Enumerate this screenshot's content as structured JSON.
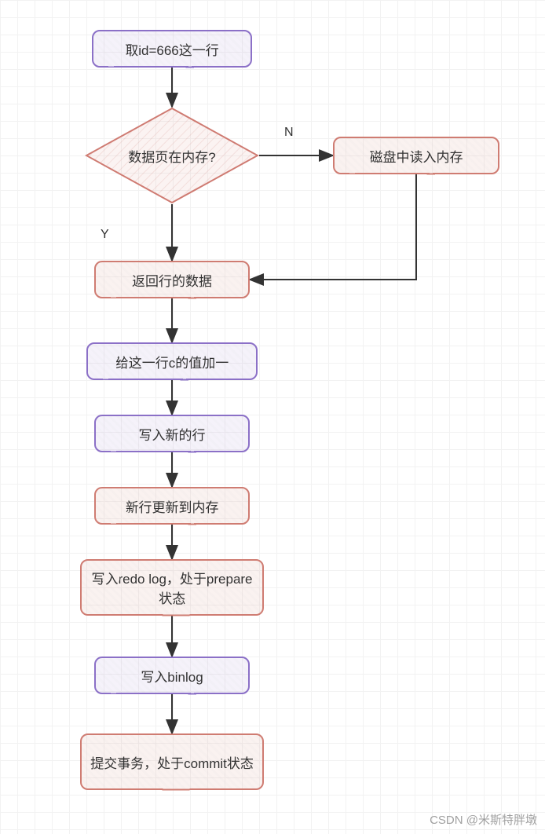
{
  "nodes": {
    "n1": {
      "text": "取id=666这一行"
    },
    "n2": {
      "text": "数据页在内存?"
    },
    "n3": {
      "text": "磁盘中读入内存"
    },
    "n4": {
      "text": "返回行的数据"
    },
    "n5": {
      "text": "给这一行c的值加一"
    },
    "n6": {
      "text": "写入新的行"
    },
    "n7": {
      "text": "新行更新到内存"
    },
    "n8": {
      "text": "写入redo log，处于prepare状态"
    },
    "n9": {
      "text": "写入binlog"
    },
    "n10": {
      "text": "提交事务，处于commit状态"
    }
  },
  "labels": {
    "yes": "Y",
    "no": "N"
  },
  "watermark": "CSDN @米斯特胖墩",
  "chart_data": {
    "type": "flowchart",
    "title": "",
    "nodes": [
      {
        "id": "n1",
        "type": "process",
        "text": "取id=666这一行",
        "style": "purple"
      },
      {
        "id": "n2",
        "type": "decision",
        "text": "数据页在内存?",
        "style": "red"
      },
      {
        "id": "n3",
        "type": "process",
        "text": "磁盘中读入内存",
        "style": "red"
      },
      {
        "id": "n4",
        "type": "process",
        "text": "返回行的数据",
        "style": "red"
      },
      {
        "id": "n5",
        "type": "process",
        "text": "给这一行c的值加一",
        "style": "purple"
      },
      {
        "id": "n6",
        "type": "process",
        "text": "写入新的行",
        "style": "purple"
      },
      {
        "id": "n7",
        "type": "process",
        "text": "新行更新到内存",
        "style": "red"
      },
      {
        "id": "n8",
        "type": "process",
        "text": "写入redo log，处于prepare状态",
        "style": "red"
      },
      {
        "id": "n9",
        "type": "process",
        "text": "写入binlog",
        "style": "purple"
      },
      {
        "id": "n10",
        "type": "process",
        "text": "提交事务，处于commit状态",
        "style": "red"
      }
    ],
    "edges": [
      {
        "from": "n1",
        "to": "n2",
        "label": ""
      },
      {
        "from": "n2",
        "to": "n3",
        "label": "N"
      },
      {
        "from": "n2",
        "to": "n4",
        "label": "Y"
      },
      {
        "from": "n3",
        "to": "n4",
        "label": ""
      },
      {
        "from": "n4",
        "to": "n5",
        "label": ""
      },
      {
        "from": "n5",
        "to": "n6",
        "label": ""
      },
      {
        "from": "n6",
        "to": "n7",
        "label": ""
      },
      {
        "from": "n7",
        "to": "n8",
        "label": ""
      },
      {
        "from": "n8",
        "to": "n9",
        "label": ""
      },
      {
        "from": "n9",
        "to": "n10",
        "label": ""
      }
    ],
    "colors": {
      "purple": "#8b6fc7",
      "red": "#cf7b72"
    }
  }
}
